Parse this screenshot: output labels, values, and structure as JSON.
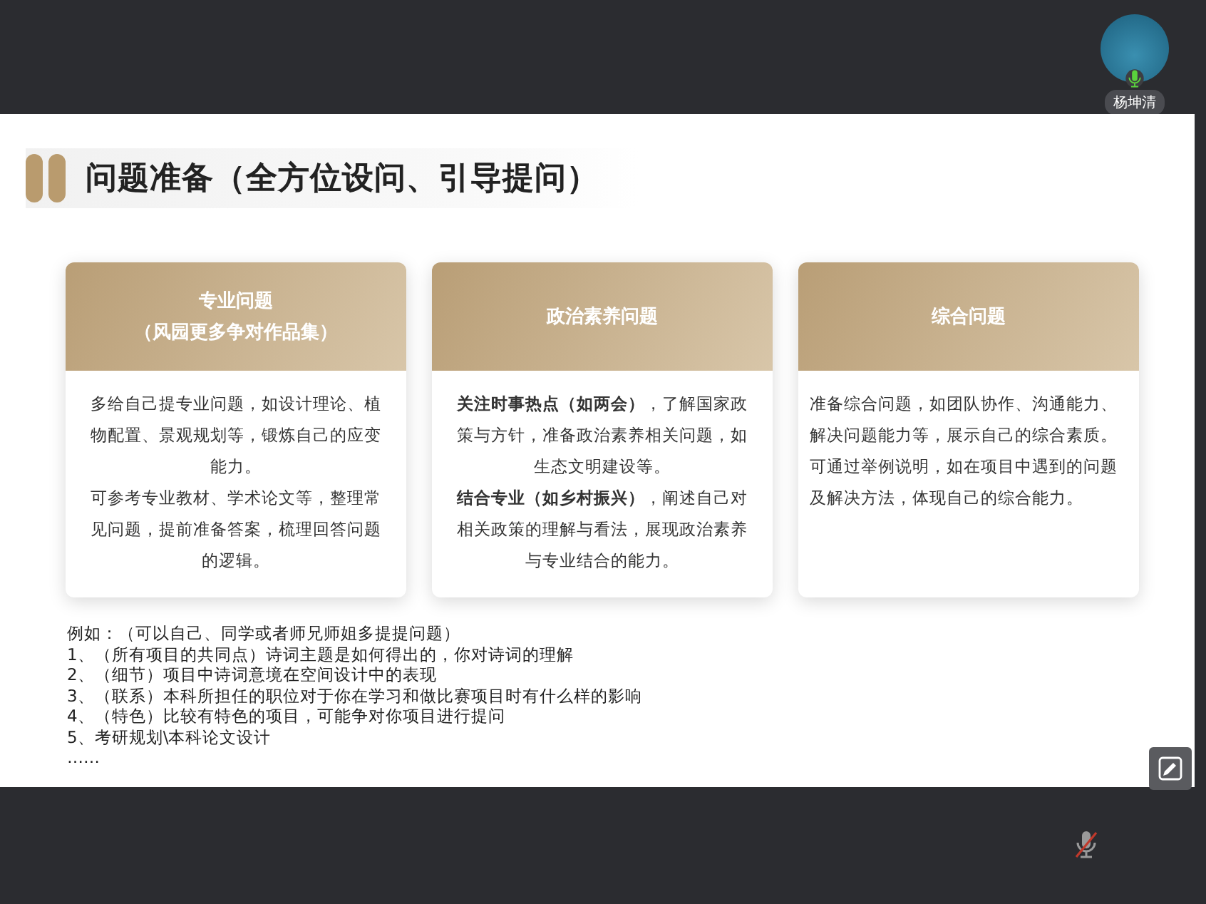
{
  "participant": {
    "name": "杨坤清",
    "mic_on": true
  },
  "slide": {
    "title": "问题准备（全方位设问、引导提问）",
    "cards": [
      {
        "heading": [
          "专业问题",
          "（风园更多争对作品集）"
        ],
        "paragraphs": [
          "多给自己提专业问题，如设计理论、植物配置、景观规划等，锻炼自己的应变能力。",
          "可参考专业教材、学术论文等，整理常见问题，提前准备答案，梳理回答问题的逻辑。"
        ]
      },
      {
        "heading": [
          "政治素养问题"
        ],
        "paragraphs": [
          "**关注时事热点（如两会）**，了解国家政策与方针，准备政治素养相关问题，如生态文明建设等。",
          "**结合专业（如乡村振兴）**，阐述自己对相关政策的理解与看法，展现政治素养与专业结合的能力。"
        ]
      },
      {
        "heading": [
          "综合问题"
        ],
        "paragraphs": [
          "准备综合问题，如团队协作、沟通能力、解决问题能力等，展示自己的综合素质。",
          "可通过举例说明，如在项目中遇到的问题及解决方法，体现自己的综合能力。"
        ]
      }
    ],
    "examples": [
      "例如：（可以自己、同学或者师兄师姐多提提问题）",
      "1、（所有项目的共同点）诗词主题是如何得出的，你对诗词的理解",
      "2、（细节）项目中诗词意境在空间设计中的表现",
      "3、（联系）本科所担任的职位对于你在学习和做比赛项目时有什么样的影响",
      "4、（特色）比较有特色的项目，可能争对你项目进行提问",
      "5、考研规划\\本科论文设计",
      "……"
    ]
  },
  "bottom_bar": {
    "mic_muted": true
  }
}
